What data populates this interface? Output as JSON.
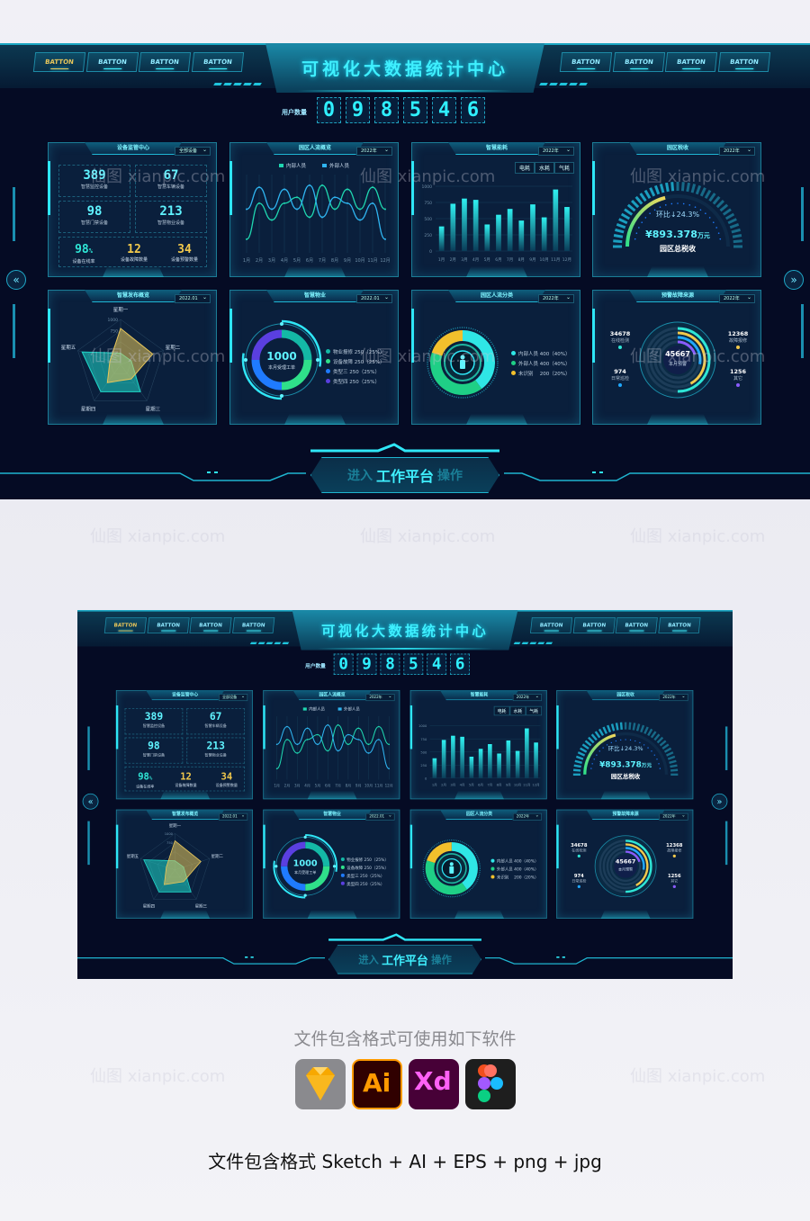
{
  "watermark": "仙图 xianpic.com",
  "header": {
    "title": "可视化大数据统计中心",
    "nav_left": [
      "BATTON",
      "BATTON",
      "BATTON",
      "BATTON"
    ],
    "nav_right": [
      "BATTON",
      "BATTON",
      "BATTON",
      "BATTON"
    ],
    "active_index": 0
  },
  "user_count": {
    "label": "用户数量",
    "digits": [
      "0",
      "9",
      "8",
      "5",
      "4",
      "6"
    ]
  },
  "side_icons": {
    "left": "«",
    "right": "»"
  },
  "device": {
    "title": "设备监管中心",
    "select": "全部设备",
    "stats": [
      {
        "value": "389",
        "label": "智慧监控设备"
      },
      {
        "value": "67",
        "label": "智慧车辆设备"
      },
      {
        "value": "98",
        "label": "智慧门禁设备"
      },
      {
        "value": "213",
        "label": "智慧物业设备"
      }
    ],
    "bottom": [
      {
        "value": "98",
        "unit": "%",
        "label": "设备在线率",
        "color": "#2fe6d6"
      },
      {
        "value": "12",
        "label": "设备故障数量",
        "color": "#f2c94c"
      },
      {
        "value": "34",
        "label": "设备预警数量",
        "color": "#f2c94c"
      }
    ]
  },
  "flow": {
    "title": "园区人流概览",
    "select": "2022年"
  },
  "energy": {
    "title": "智慧能耗",
    "select": "2022年",
    "tabs": [
      "电耗",
      "水耗",
      "气耗"
    ]
  },
  "tax": {
    "title": "园区税收",
    "select": "2022年",
    "ratio": "环比↓24.3%",
    "amount": "¥893.378",
    "unit": "万元",
    "label": "园区总税收",
    "progress": 0.42
  },
  "release": {
    "title": "智慧发布概览",
    "select": "2022.01"
  },
  "property": {
    "title": "智慧物业",
    "select": "2022.01",
    "center_value": "1000",
    "center_label": "本月受理工单",
    "legend": [
      "物业报修 250（25%）",
      "设备故障 250（25%）",
      "类型三 250（25%）",
      "类型四 250（25%）"
    ]
  },
  "distribution": {
    "title": "园区人流分类",
    "select": "2022年",
    "legend": [
      "内部人员 400（40%）",
      "外部人员 400（40%）",
      "未识别　 200（20%）"
    ]
  },
  "warning": {
    "title": "预警故障来源",
    "select": "2022年",
    "center_value": "45667",
    "center_label": "本月预警",
    "items": [
      {
        "value": "34678",
        "label": "在线检测",
        "color": "#2ee6d6"
      },
      {
        "value": "12368",
        "label": "故障报修",
        "color": "#f2c94c"
      },
      {
        "value": "974",
        "label": "日常巡检",
        "color": "#1fa8ff"
      },
      {
        "value": "1256",
        "label": "其它",
        "color": "#8a5cff"
      }
    ]
  },
  "enter_button": {
    "pre": "进入",
    "main": "工作平台",
    "post": "操作"
  },
  "footer": {
    "software_title": "文件包含格式可使用如下软件",
    "software": [
      "Sketch",
      "Ai",
      "Xd",
      "Figma"
    ],
    "formats": "文件包含格式 Sketch + AI + EPS + png + jpg"
  },
  "colors": {
    "accent": "#2ff0ff",
    "background": "#050b24",
    "panel": "#0a1f3c",
    "yellow": "#f2c94c",
    "green": "#2fe08a"
  },
  "chart_data": [
    {
      "type": "line",
      "title": "园区人流概览",
      "categories": [
        "1月",
        "2月",
        "3月",
        "4月",
        "5月",
        "6月",
        "7月",
        "8月",
        "9月",
        "10月",
        "11月",
        "12月"
      ],
      "series": [
        {
          "name": "内部人员",
          "color": "#1fd6b0",
          "values": [
            25,
            115,
            73,
            115,
            130,
            80,
            160,
            100,
            150,
            100,
            155,
            100
          ]
        },
        {
          "name": "外部人员",
          "color": "#2fb4f0",
          "values": [
            100,
            155,
            100,
            150,
            100,
            160,
            80,
            130,
            115,
            73,
            115,
            25
          ]
        }
      ],
      "grid": "vertical"
    },
    {
      "type": "bar",
      "title": "智慧能耗",
      "categories": [
        "1月",
        "2月",
        "3月",
        "4月",
        "5月",
        "6月",
        "7月",
        "8月",
        "9月",
        "10月",
        "11月",
        "12月"
      ],
      "values": [
        380,
        730,
        810,
        790,
        410,
        560,
        650,
        470,
        720,
        520,
        950,
        680
      ],
      "ylim": [
        0,
        1000
      ],
      "yticks": [
        0,
        250,
        500,
        750,
        1000
      ]
    },
    {
      "type": "radar",
      "title": "智慧发布概览",
      "axes": [
        "星期一",
        "星期二",
        "星期三",
        "星期四",
        "星期五"
      ],
      "max": 1000,
      "ticks": [
        "1000",
        "750"
      ],
      "series": [
        {
          "color": "#e8c65a",
          "values": [
            800,
            750,
            400,
            500,
            250
          ]
        },
        {
          "color": "#1fd6c8",
          "values": [
            250,
            250,
            750,
            750,
            900
          ]
        }
      ]
    },
    {
      "type": "pie",
      "title": "智慧物业",
      "values": [
        25,
        25,
        25,
        25
      ],
      "colors": [
        "#14b8a6",
        "#2fe08a",
        "#1f7bff",
        "#5a3fe0"
      ]
    },
    {
      "type": "pie",
      "title": "园区人流分类",
      "values": [
        40,
        40,
        20
      ],
      "colors": [
        "#2fe6e6",
        "#1fcf86",
        "#f2c02c"
      ]
    },
    {
      "type": "pie",
      "title": "预警故障来源",
      "values": [
        34678,
        12368,
        974,
        1256
      ],
      "colors": [
        "#2ee6d6",
        "#f2c94c",
        "#1fa8ff",
        "#8a5cff"
      ]
    }
  ]
}
